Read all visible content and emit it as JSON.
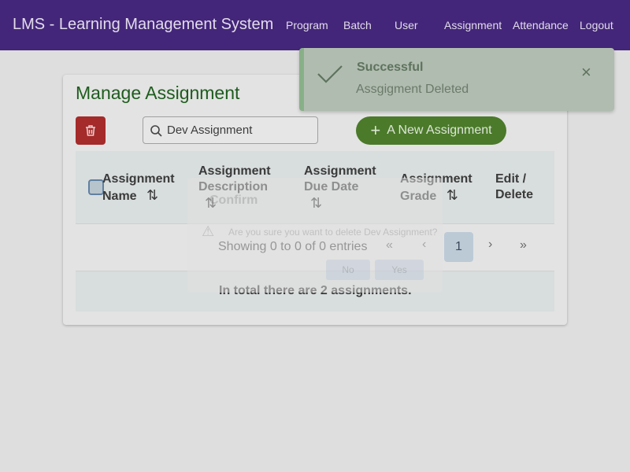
{
  "nav": {
    "brand": "LMS - Learning Management System",
    "links": [
      "Program",
      "Batch",
      "User",
      "Assignment",
      "Attendance",
      "Logout"
    ]
  },
  "page": {
    "title": "Manage Assignment",
    "search_value": "Dev Assignment",
    "new_button": "A New Assignment"
  },
  "table": {
    "headers": [
      [
        "Assignment",
        "Name"
      ],
      [
        "Assignment",
        "Description"
      ],
      [
        "Assignment",
        "Due Date"
      ],
      [
        "Assignment",
        "Grade"
      ],
      [
        "Edit /",
        "Delete"
      ]
    ],
    "sort_icon": "⇅"
  },
  "pagination": {
    "info": "Showing 0 to 0 of 0 entries",
    "current_page": "1",
    "first": "«",
    "prev": "‹",
    "next": "›",
    "last": "»"
  },
  "footer": "In total there are 2 assignments.",
  "dialog": {
    "title": "Confirm",
    "message": "Are you sure you want to delete Dev Assignment?",
    "no": "No",
    "yes": "Yes"
  },
  "toast": {
    "title": "Successful",
    "message": "Assgigment Deleted"
  }
}
